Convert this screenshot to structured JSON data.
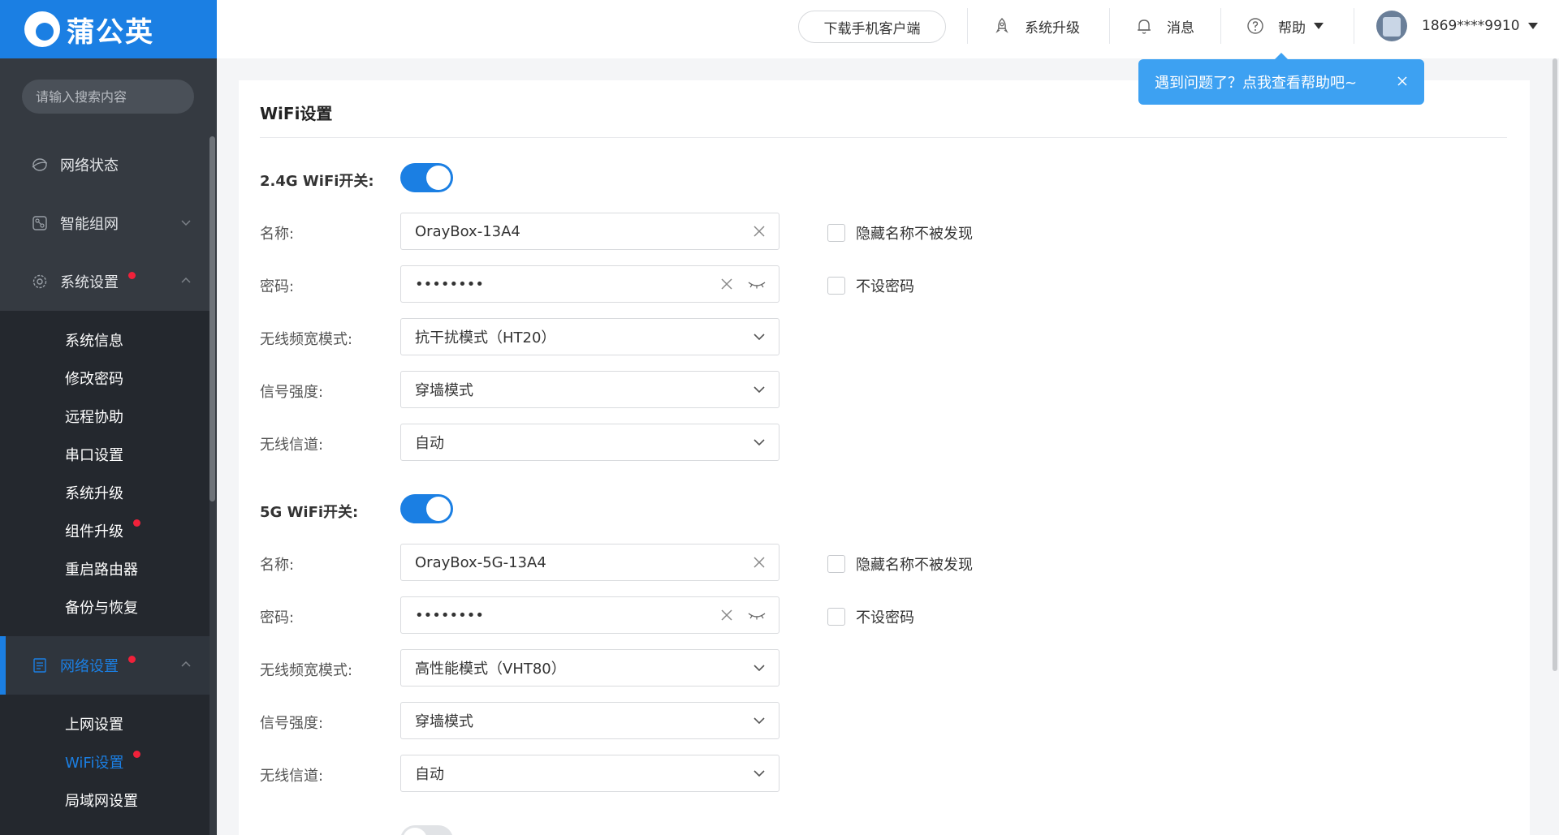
{
  "brand": {
    "name": "蒲公英",
    "accent": "#1b7fe3"
  },
  "sidebar": {
    "search_placeholder": "请输入搜索内容",
    "menu": [
      {
        "label": "网络状态",
        "icon": "globe-icon",
        "active": false,
        "badge": false
      },
      {
        "label": "智能组网",
        "icon": "network-icon",
        "active": false,
        "badge": false,
        "expandable": true
      },
      {
        "label": "系统设置",
        "icon": "gear-icon",
        "active": false,
        "badge": true,
        "expandable": true,
        "expanded": true,
        "children": [
          "系统信息",
          "修改密码",
          "远程协助",
          "串口设置",
          "系统升级",
          "组件升级",
          "重启路由器",
          "备份与恢复"
        ]
      },
      {
        "label": "网络设置",
        "icon": "document-icon",
        "active": true,
        "badge": true,
        "expandable": true,
        "expanded": true,
        "children": [
          "上网设置",
          "WiFi设置",
          "局域网设置"
        ]
      }
    ],
    "badged_children": [
      "组件升级",
      "WiFi设置"
    ],
    "active_child": "WiFi设置"
  },
  "header": {
    "download_label": "下载手机客户端",
    "upgrade_label": "系统升级",
    "messages_label": "消息",
    "help_label": "帮助",
    "user_phone": "1869****9910"
  },
  "tooltip": {
    "text": "遇到问题了？点我查看帮助吧~"
  },
  "wifi": {
    "title": "WiFi设置",
    "band_24": {
      "switch_label": "2.4G WiFi开关:",
      "enabled": true,
      "name_label": "名称:",
      "name_value": "OrayBox-13A4",
      "hide_label": "隐藏名称不被发现",
      "password_label": "密码:",
      "password_value": "••••••••",
      "no_password_label": "不设密码",
      "bandwidth_label": "无线频宽模式:",
      "bandwidth_value": "抗干扰模式（HT20）",
      "signal_label": "信号强度:",
      "signal_value": "穿墙模式",
      "channel_label": "无线信道:",
      "channel_value": "自动"
    },
    "band_5": {
      "switch_label": "5G WiFi开关:",
      "enabled": true,
      "name_label": "名称:",
      "name_value": "OrayBox-5G-13A4",
      "hide_label": "隐藏名称不被发现",
      "password_label": "密码:",
      "password_value": "••••••••",
      "no_password_label": "不设密码",
      "bandwidth_label": "无线频宽模式:",
      "bandwidth_value": "高性能模式（VHT80）",
      "signal_label": "信号强度:",
      "signal_value": "穿墙模式",
      "channel_label": "无线信道:",
      "channel_value": "自动"
    },
    "guest_toggle_enabled": false
  }
}
